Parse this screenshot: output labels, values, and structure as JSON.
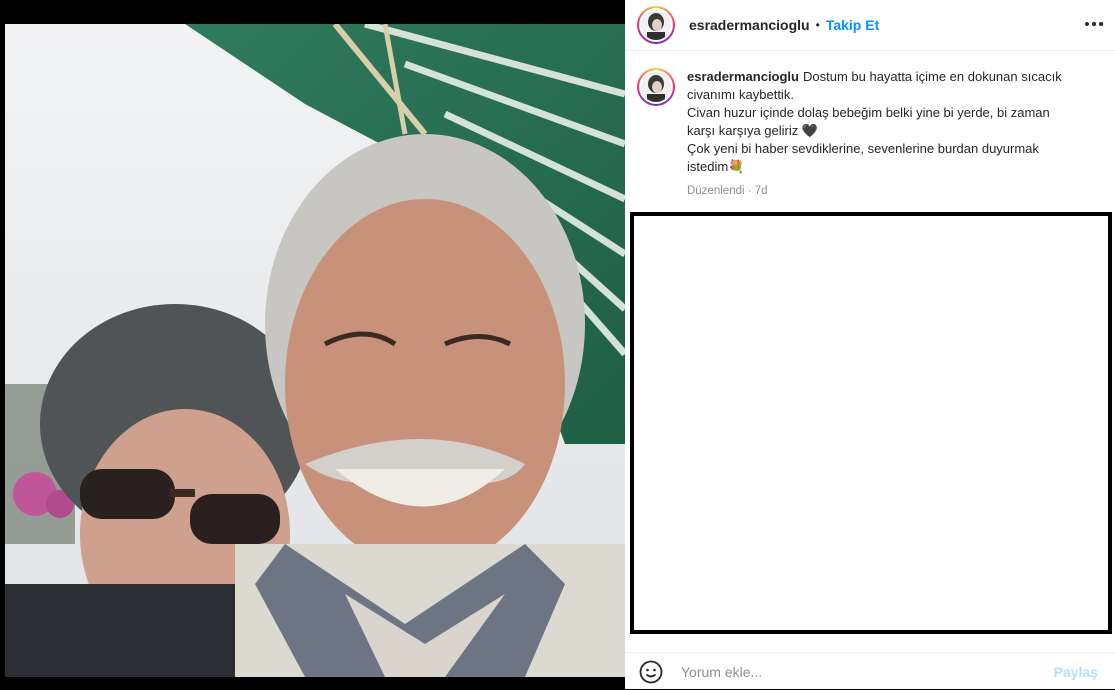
{
  "post": {
    "username": "esradermancioglu",
    "follow_label": "Takip Et",
    "separator": "•",
    "caption_lines": [
      "Dostum bu hayatta içime en dokunan sıcacık",
      "civanımı kaybettik.",
      "Civan huzur içinde dolaş bebeğim belki yine bi yerde, bi zaman",
      "karşı karşıya geliriz 🖤",
      "Çok yeni bi haber sevdiklerine, sevenlerine burdan duyurmak",
      "istedim💐"
    ],
    "edited_label": "Düzenlendi · 7d"
  },
  "comment_box": {
    "placeholder": "Yorum ekle...",
    "post_label": "Paylaş"
  },
  "icons": {
    "more": "more-options-icon",
    "emoji": "emoji-smile-icon"
  },
  "colors": {
    "link_blue": "#0095f6",
    "disabled_blue": "#b2dffc"
  }
}
